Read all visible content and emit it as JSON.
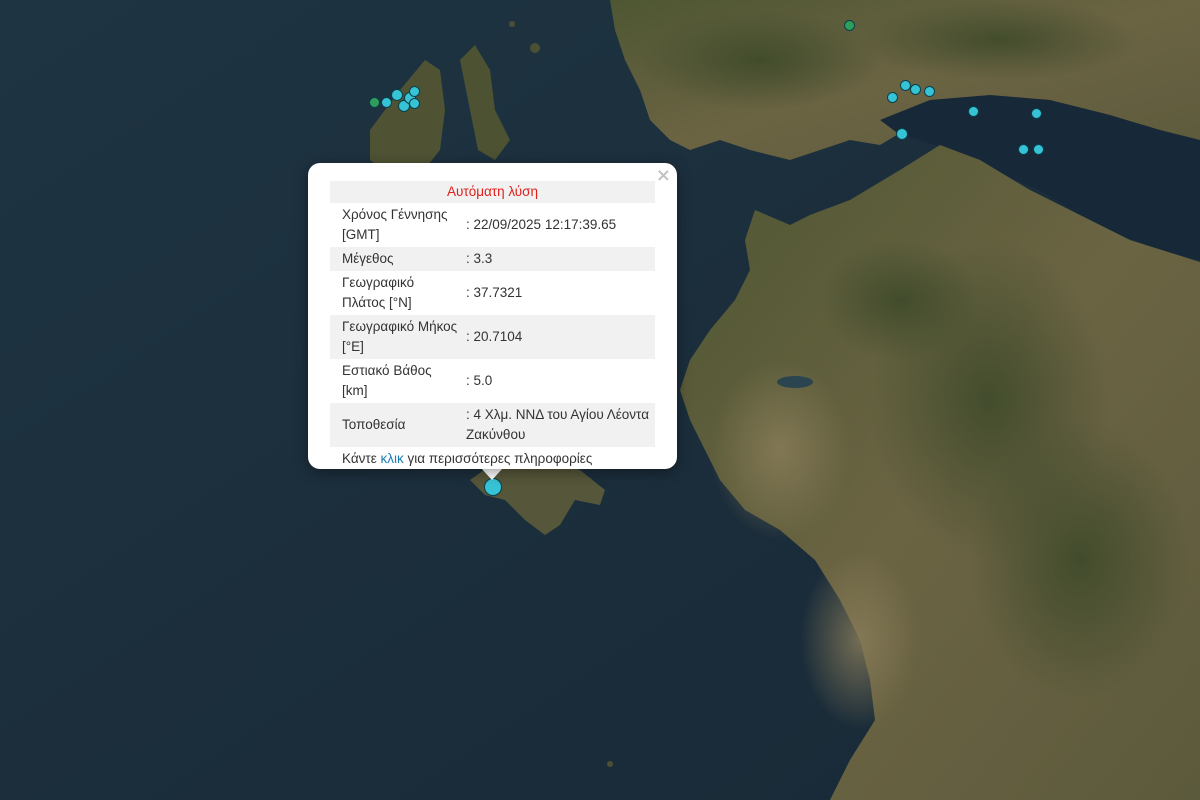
{
  "popup": {
    "title": "Αυτόματη λύση",
    "close_label": "×",
    "rows": [
      {
        "label": "Χρόνος Γέννησης [GMT]",
        "value": ": 22/09/2025 12:17:39.65"
      },
      {
        "label": "Μέγεθος",
        "value": ": 3.3"
      },
      {
        "label": "Γεωγραφικό Πλάτος [°N]",
        "value": ": 37.7321"
      },
      {
        "label": "Γεωγραφικό Μήκος [°E]",
        "value": ": 20.7104"
      },
      {
        "label": "Εστιακό Βάθος [km]",
        "value": ": 5.0"
      },
      {
        "label": "Τοποθεσία",
        "value": ": 4 Χλμ. ΝΝΔ του Αγίου Λέοντα Ζακύνθου"
      }
    ],
    "footer_before": "Κάντε ",
    "footer_link": "κλικ",
    "footer_after": " για περισσότερες πληροφορίες"
  },
  "colors": {
    "sea": "#1b2e3c",
    "land": "#5b5a3a",
    "marker": "#37c3d6",
    "marker_old": "#2f9e5a",
    "title": "#e0201c",
    "link": "#1c7db4"
  }
}
